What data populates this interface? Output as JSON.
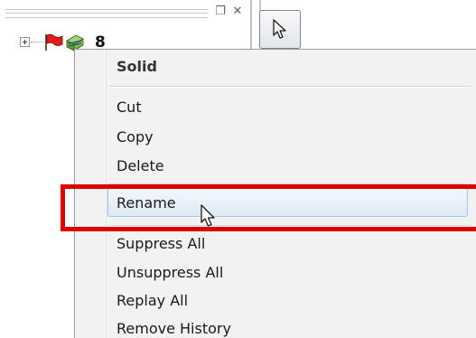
{
  "tree": {
    "label": "8"
  },
  "panel_icons": {
    "restore": "restore-icon",
    "close": "close-icon",
    "expander": "expand-plus-icon",
    "flag": "red-flag-icon",
    "solid": "solid-body-icon"
  },
  "toolbar": {
    "select_icon": "arrow-pointer-icon"
  },
  "menu": {
    "title": "Solid",
    "items": [
      {
        "label": "Cut"
      },
      {
        "label": "Copy"
      },
      {
        "label": "Delete"
      },
      {
        "label": "Rename"
      },
      {
        "label": "Suppress All"
      },
      {
        "label": "Unsuppress All"
      },
      {
        "label": "Replay All"
      },
      {
        "label": "Remove History"
      }
    ],
    "hovered": "Rename"
  },
  "colors": {
    "highlight_border": "#e00000",
    "hover_fill": "#dde9f7",
    "menu_bg": "#f2f2f2"
  }
}
